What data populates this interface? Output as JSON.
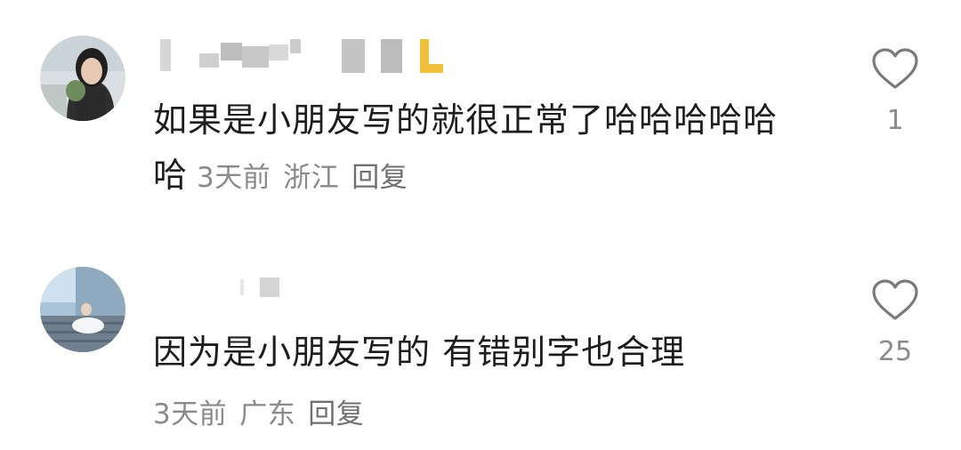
{
  "comments": [
    {
      "text": "如果是小朋友写的就很正常了哈哈哈哈哈哈",
      "time": "3天前",
      "location": "浙江",
      "reply_label": "回复",
      "likes": "1"
    },
    {
      "text": "因为是小朋友写的 有错别字也合理",
      "time": "3天前",
      "location": "广东",
      "reply_label": "回复",
      "likes": "25"
    }
  ],
  "icons": {
    "like": "heart-outline-icon"
  },
  "colors": {
    "text": "#1d1d1d",
    "meta": "#8a8a8a",
    "icon": "#7a7a7a",
    "background": "#ffffff"
  }
}
